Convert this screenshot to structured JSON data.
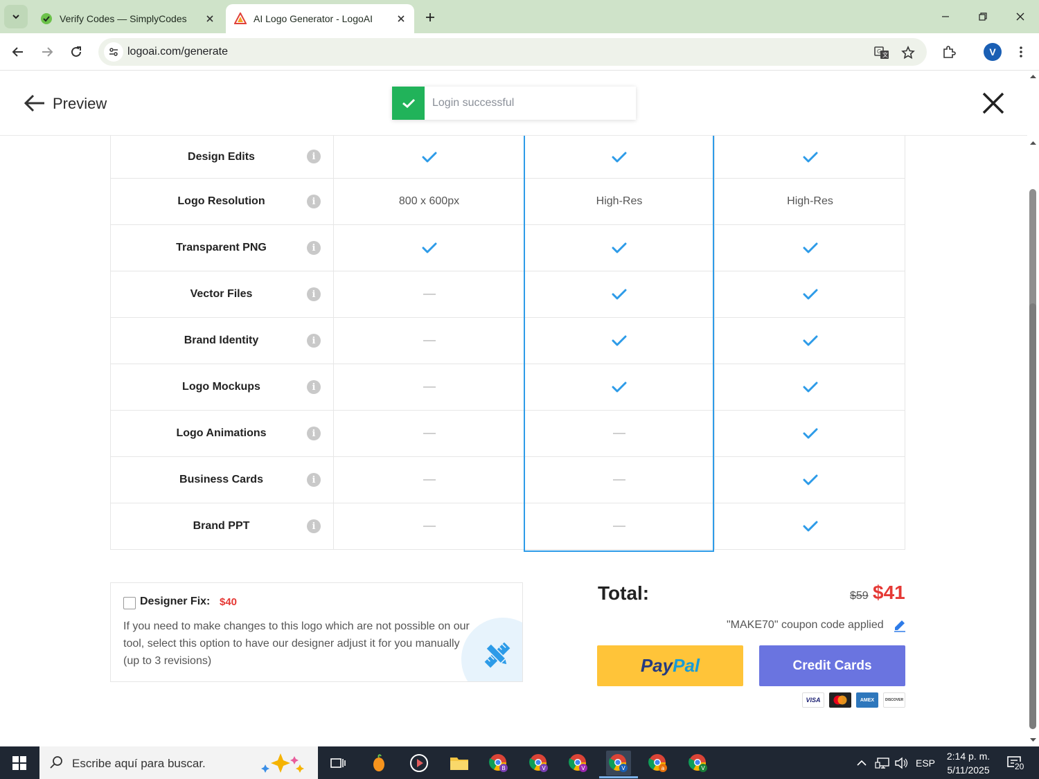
{
  "browser": {
    "tabs": [
      {
        "title": "Verify Codes — SimplyCodes",
        "active": false
      },
      {
        "title": "AI Logo Generator - LogoAI",
        "active": true
      }
    ],
    "url": "logoai.com/generate",
    "profile_initial": "V"
  },
  "header": {
    "back_label": "Preview",
    "toast": "Login successful"
  },
  "features": [
    {
      "name": "Design Edits",
      "values": [
        "check",
        "check",
        "check"
      ]
    },
    {
      "name": "Logo Resolution",
      "values": [
        "800 x 600px",
        "High-Res",
        "High-Res"
      ]
    },
    {
      "name": "Transparent PNG",
      "values": [
        "check",
        "check",
        "check"
      ]
    },
    {
      "name": "Vector Files",
      "values": [
        "dash",
        "check",
        "check"
      ]
    },
    {
      "name": "Brand Identity",
      "values": [
        "dash",
        "check",
        "check"
      ]
    },
    {
      "name": "Logo Mockups",
      "values": [
        "dash",
        "check",
        "check"
      ]
    },
    {
      "name": "Logo Animations",
      "values": [
        "dash",
        "dash",
        "check"
      ]
    },
    {
      "name": "Business Cards",
      "values": [
        "dash",
        "dash",
        "check"
      ]
    },
    {
      "name": "Brand PPT",
      "values": [
        "dash",
        "dash",
        "check"
      ]
    }
  ],
  "designer_fix": {
    "label": "Designer Fix:",
    "price": "$40",
    "description": "If you need to make changes to this logo which are not possible on our tool, select this option to have our designer adjust it for you manually (up to 3 revisions)"
  },
  "checkout": {
    "total_label": "Total:",
    "old_price": "$59",
    "new_price": "$41",
    "coupon_text": "\"MAKE70\" coupon code applied",
    "paypal_part1": "Pay",
    "paypal_part2": "Pal",
    "credit_cards_label": "Credit Cards",
    "cards": [
      "VISA",
      "MC",
      "AMEX",
      "DISCOVER"
    ]
  },
  "taskbar": {
    "search_placeholder": "Escribe aquí para buscar.",
    "language": "ESP",
    "time": "2:14 p. m.",
    "date": "5/11/2025",
    "notifications": "20",
    "chrome_badges": [
      "B",
      "V",
      "V",
      "V",
      "a",
      "V"
    ]
  },
  "colors": {
    "accent_blue": "#2d9be8",
    "price_red": "#e53935",
    "paypal_yellow": "#ffc439",
    "credit_purple": "#6a74e0",
    "toast_green": "#21b35a"
  }
}
